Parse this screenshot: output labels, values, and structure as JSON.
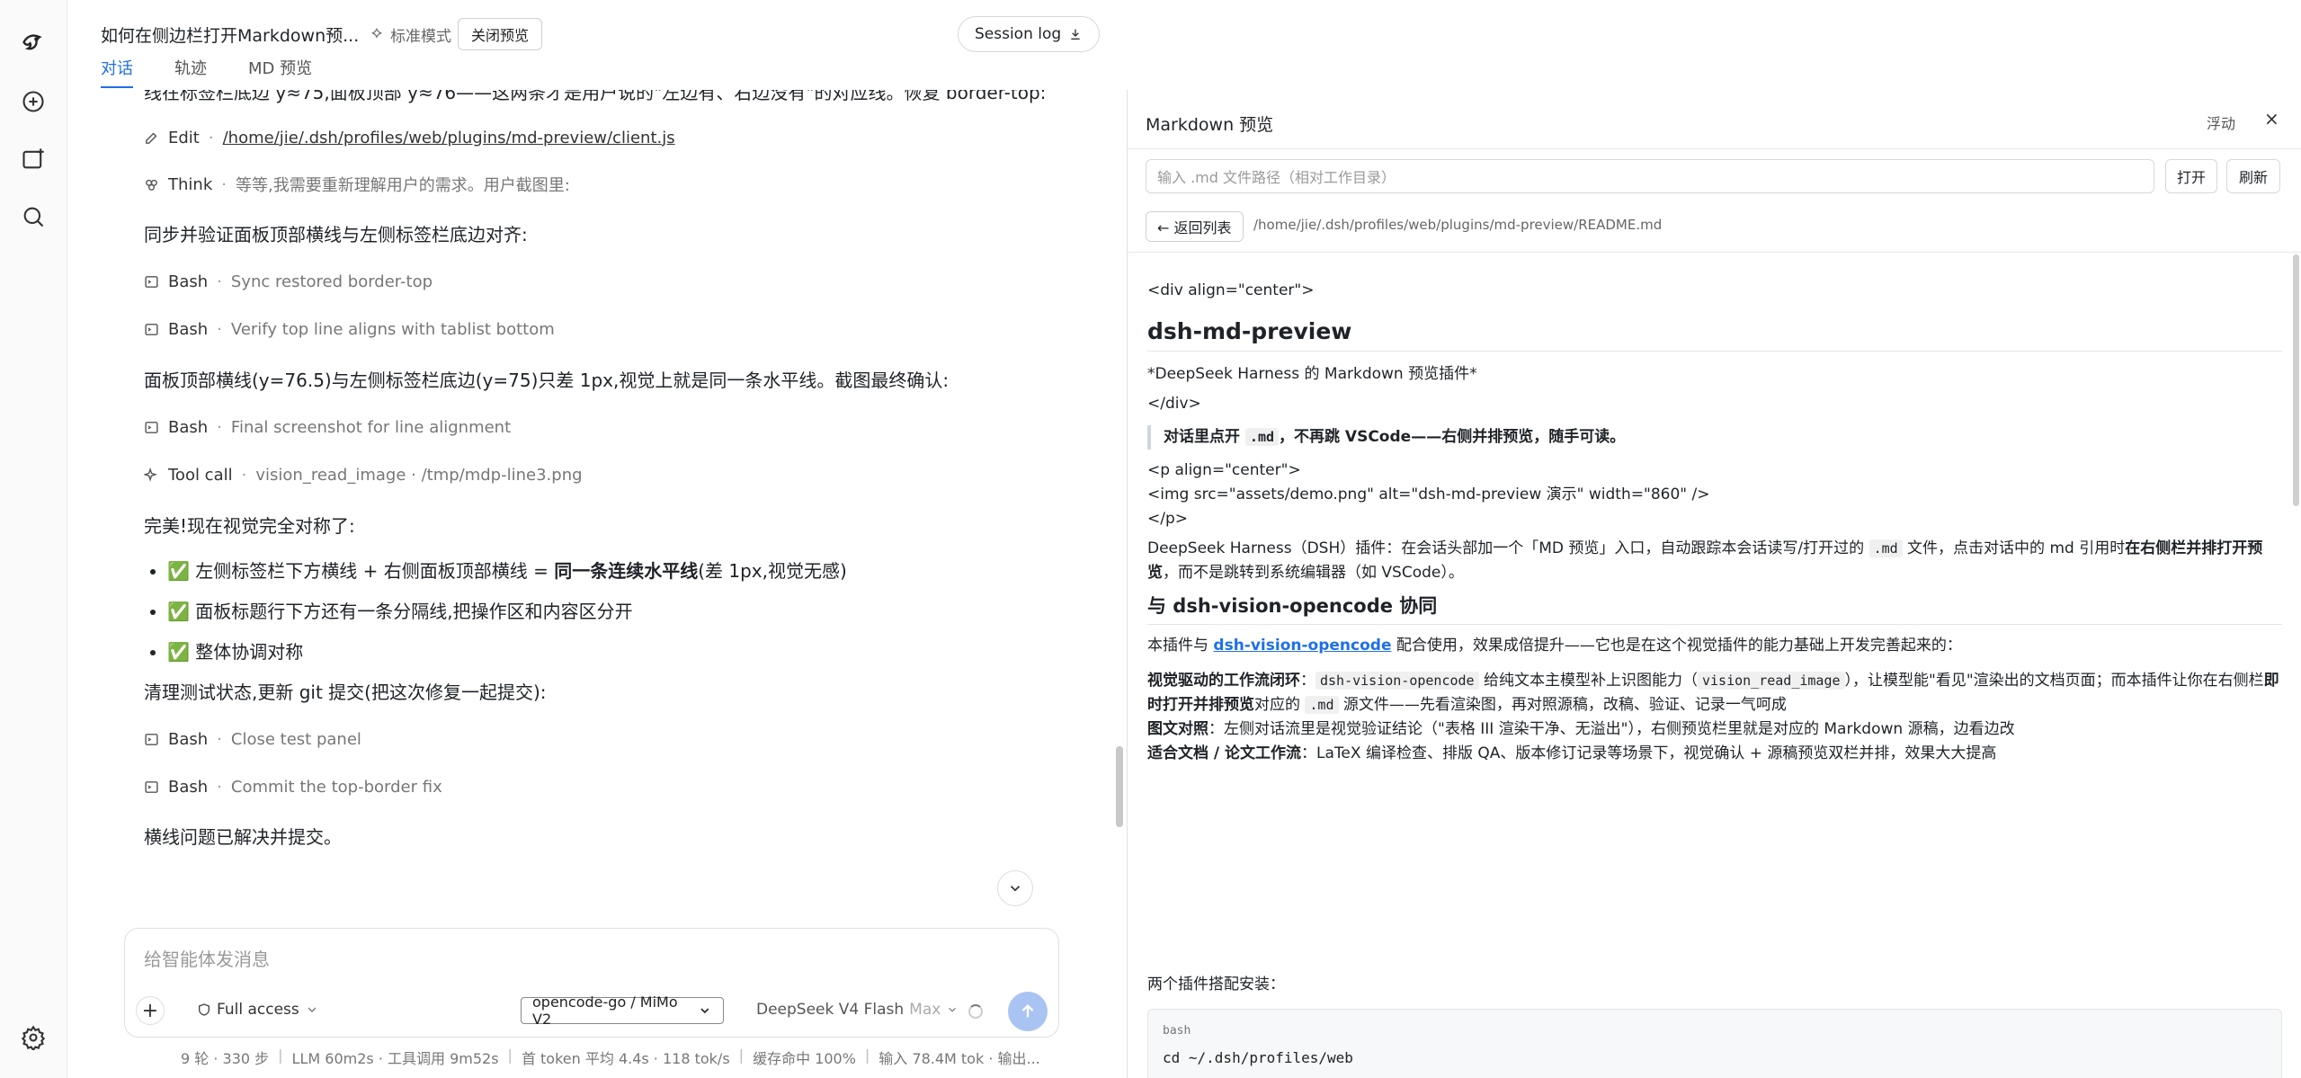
{
  "header": {
    "conversation_title": "如何在侧边栏打开Markdown预...",
    "mode_label": "标准模式",
    "close_preview_label": "关闭预览",
    "session_log_label": "Session log",
    "tabs": [
      {
        "label": "对话",
        "active": true
      },
      {
        "label": "轨迹",
        "active": false
      },
      {
        "label": "MD 预览",
        "active": false
      }
    ]
  },
  "chat": {
    "intro_text": "线在标签栏底边 y≈75,面板顶部 y≈76——这两条才是用户说的\"左边有、右边没有\"的对应线。恢复 border-top:",
    "edit_tool": {
      "name": "Edit",
      "path": "/home/jie/.dsh/profiles/web/plugins/md-preview/client.js"
    },
    "think_tool": {
      "name": "Think",
      "desc": "等等,我需要重新理解用户的需求。用户截图里:"
    },
    "sync_text": "同步并验证面板顶部横线与左侧标签栏底边对齐:",
    "bash1": {
      "name": "Bash",
      "desc": "Sync restored border-top"
    },
    "bash2": {
      "name": "Bash",
      "desc": "Verify top line aligns with tablist bottom"
    },
    "compare_text": "面板顶部横线(y=76.5)与左侧标签栏底边(y=75)只差 1px,视觉上就是同一条水平线。截图最终确认:",
    "bash3": {
      "name": "Bash",
      "desc": "Final screenshot for line alignment"
    },
    "toolcall": {
      "name": "Tool call",
      "desc": "vision_read_image · /tmp/mdp-line3.png"
    },
    "perfect_text": "完美!现在视觉完全对称了:",
    "checks": [
      {
        "prefix": "✅ 左侧标签栏下方横线 + 右侧面板顶部横线 = ",
        "bold": "同一条连续水平线",
        "suffix": "(差 1px,视觉无感)"
      },
      {
        "prefix": "✅ 面板标题行下方还有一条分隔线,把操作区和内容区分开",
        "bold": "",
        "suffix": ""
      },
      {
        "prefix": "✅ 整体协调对称",
        "bold": "",
        "suffix": ""
      }
    ],
    "cleanup_text": "清理测试状态,更新 git 提交(把这次修复一起提交):",
    "bash4": {
      "name": "Bash",
      "desc": "Close test panel"
    },
    "bash5": {
      "name": "Bash",
      "desc": "Commit the top-border fix"
    },
    "final_text": "横线问题已解决并提交。"
  },
  "composer": {
    "placeholder": "给智能体发消息",
    "access_label": "Full access",
    "model_select": "opencode-go / MiMo V2",
    "model2_label": "DeepSeek V4 Flash",
    "model2_suffix": "Max"
  },
  "statusbar": {
    "items": [
      "9 轮 · 330 步",
      "LLM 60m2s · 工具调用 9m52s",
      "首 token 平均 4.4s · 118 tok/s",
      "缓存命中 100%",
      "输入 78.4M tok · 输出..."
    ]
  },
  "panel": {
    "title": "Markdown 预览",
    "float_label": "浮动",
    "close_label": "×",
    "path_placeholder": "输入 .md 文件路径（相对工作目录）",
    "open_label": "打开",
    "refresh_label": "刷新",
    "back_label": "← 返回列表",
    "file_path": "/home/jie/.dsh/profiles/web/plugins/md-preview/README.md",
    "md": {
      "div_open": "<div align=\"center\">",
      "h1": "dsh-md-preview",
      "subtitle": "*DeepSeek Harness 的 Markdown 预览插件*",
      "div_close": "</div>",
      "quote_pre": "对话里点开 ",
      "quote_code": ".md",
      "quote_post": "，不再跳 VSCode——右侧并排预览，随手可读。",
      "p_open": "<p align=\"center\">",
      "img_line": "<img src=\"assets/demo.png\" alt=\"dsh-md-preview 演示\" width=\"860\" />",
      "p_close": "</p>",
      "desc_pre": "DeepSeek Harness（DSH）插件：在会话头部加一个「MD 预览」入口，自动跟踪本会话读写/打开过的 ",
      "desc_code": ".md",
      "desc_mid": " 文件，点击对话中的 md 引用时",
      "desc_bold": "在右侧栏并排打开预览",
      "desc_post": "，而不是跳转到系统编辑器（如 VSCode）。",
      "h2": "与 dsh-vision-opencode 协同",
      "coop_pre": "本插件与 ",
      "coop_link": "dsh-vision-opencode",
      "coop_post": " 配合使用，效果成倍提升——它也是在这个视觉插件的能力基础上开发完善起来的：",
      "f1_bold": "视觉驱动的工作流闭环",
      "f1_a": "：",
      "f1_code1": "dsh-vision-opencode",
      "f1_b": " 给纯文本主模型补上识图能力（",
      "f1_code2": "vision_read_image",
      "f1_c": "），让模型能\"看见\"渲染出的文档页面；而本插件让你在右侧栏",
      "f1_bold2": "即时打开并排预览",
      "f1_d": "对应的 ",
      "f1_code3": ".md",
      "f1_e": " 源文件——先看渲染图，再对照源稿，改稿、验证、记录一气呵成",
      "f2_bold": "图文对照",
      "f2_text": "：左侧对话流里是视觉验证结论（\"表格 III 渲染干净、无溢出\"），右侧预览栏里就是对应的 Markdown 源稿，边看边改",
      "f3_bold": "适合文档 / 论文工作流",
      "f3_text": "：LaTeX 编译检查、排版 QA、版本修订记录等场景下，视觉确认 + 源稿预览双栏并排，效果大大提高",
      "install_label": "两个插件搭配安装：",
      "code_lang": "bash",
      "code_line1": "cd ~/.dsh/profiles/web",
      "code_line2": "..."
    }
  }
}
